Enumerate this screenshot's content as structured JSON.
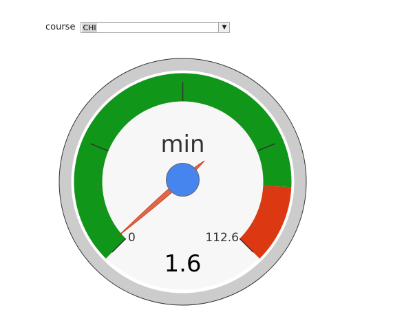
{
  "course": {
    "label": "course",
    "selected": "CHI",
    "dropdown_icon": "triangle-down-icon"
  },
  "gauge": {
    "label": "min",
    "value": 1.6,
    "value_text": "1.6",
    "min": 0,
    "max": 112.6,
    "min_text": "0",
    "max_text": "112.6",
    "green_band": [
      0,
      95
    ],
    "red_band": [
      95,
      112.6
    ],
    "colors": {
      "green": "#109618",
      "red": "#dc3912",
      "needle": "#e1674b",
      "hub": "#4684ee",
      "outer_ring": "#cccccc",
      "face": "#f7f7f7"
    }
  }
}
